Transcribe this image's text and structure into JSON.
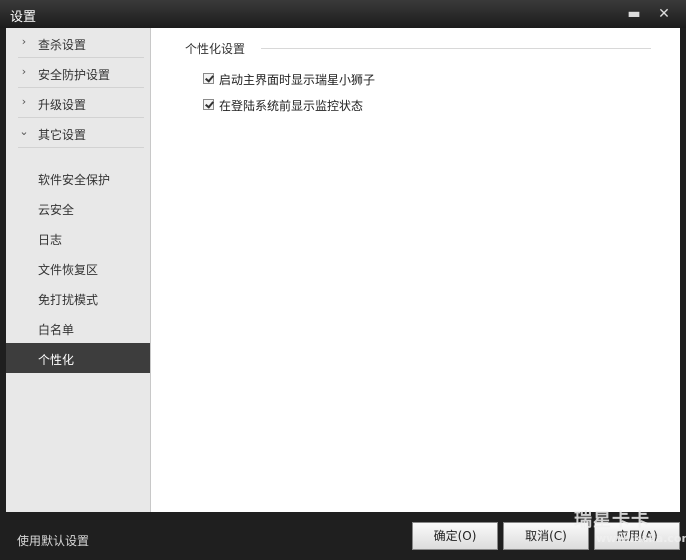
{
  "window": {
    "title": "设置"
  },
  "titlebar": {
    "minimize_icon": "minimize-icon",
    "close_icon": "close-icon"
  },
  "sidebar": {
    "groups": [
      {
        "label": "查杀设置",
        "expanded": false
      },
      {
        "label": "安全防护设置",
        "expanded": false
      },
      {
        "label": "升级设置",
        "expanded": false
      },
      {
        "label": "其它设置",
        "expanded": true
      }
    ],
    "subitems": [
      {
        "label": "软件安全保护"
      },
      {
        "label": "云安全"
      },
      {
        "label": "日志"
      },
      {
        "label": "文件恢复区"
      },
      {
        "label": "免打扰模式"
      },
      {
        "label": "白名单"
      },
      {
        "label": "个性化",
        "active": true
      }
    ]
  },
  "main": {
    "section_title": "个性化设置",
    "options": [
      {
        "label": "启动主界面时显示瑞星小狮子",
        "checked": true
      },
      {
        "label": "在登陆系统前显示监控状态",
        "checked": true
      }
    ]
  },
  "footer": {
    "default_label": "使用默认设置",
    "ok_label": "确定(O)",
    "cancel_label": "取消(C)",
    "apply_label": "应用(A)"
  },
  "watermark": {
    "brand": "瑞星卡卡",
    "url": "www.ikaka.com"
  }
}
